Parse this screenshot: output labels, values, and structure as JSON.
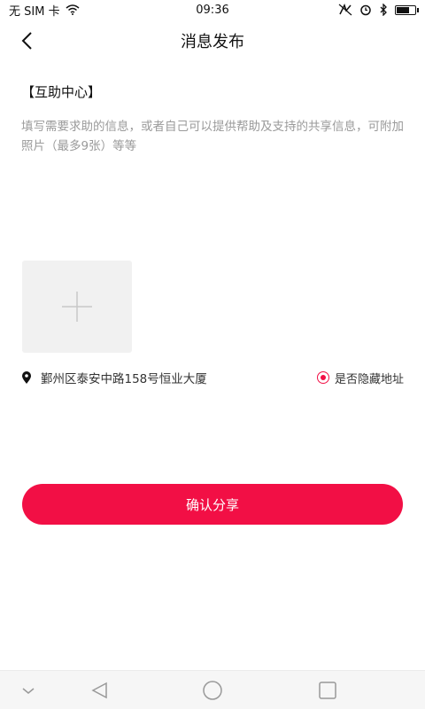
{
  "status_bar": {
    "carrier": "无 SIM 卡",
    "time": "09:36",
    "battery_level": 0.75,
    "icons": [
      "wifi-icon",
      "nfc-icon",
      "alarm-icon",
      "bluetooth-icon",
      "battery-icon"
    ]
  },
  "header": {
    "title": "消息发布",
    "back_icon": "back-arrow-icon"
  },
  "section": {
    "title": "【互助中心】"
  },
  "content": {
    "value": "",
    "placeholder": "填写需要求助的信息，或者自己可以提供帮助及支持的共享信息，可附加照片（最多9张）等等"
  },
  "photo_picker": {
    "icon": "plus-icon"
  },
  "location": {
    "icon": "location-pin-icon",
    "address": "鄞州区泰安中路158号恒业大厦",
    "hide_label": "是否隐藏地址",
    "hide_selected": true
  },
  "actions": {
    "confirm_label": "确认分享"
  },
  "colors": {
    "accent": "#f20f45",
    "placeholder": "#9a9a9a",
    "photo_bg": "#f1f1f1",
    "system_nav_bg": "#f6f6f6"
  },
  "system_nav": {
    "icons": [
      "collapse-icon",
      "back-triangle-icon",
      "home-circle-icon",
      "recents-square-icon"
    ]
  }
}
